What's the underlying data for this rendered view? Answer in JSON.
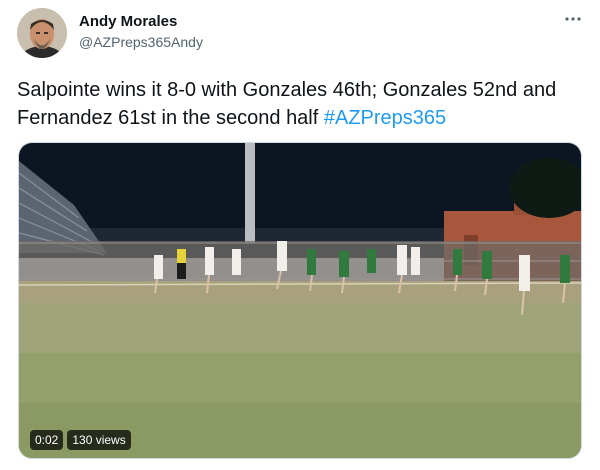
{
  "author": {
    "display_name": "Andy Morales",
    "handle": "@AZPreps365Andy"
  },
  "tweet": {
    "text": "Salpointe wins it 8-0 with Gonzales 46th; Gonzales 52nd and Fernandez 61st in the second half ",
    "hashtag": "#AZPreps365"
  },
  "video": {
    "timestamp": "0:02",
    "views": "130 views"
  },
  "icons": {
    "more": "more-horizontal-icon"
  },
  "colors": {
    "link": "#1d9bf0",
    "text": "#0f1419",
    "secondary": "#536471"
  }
}
